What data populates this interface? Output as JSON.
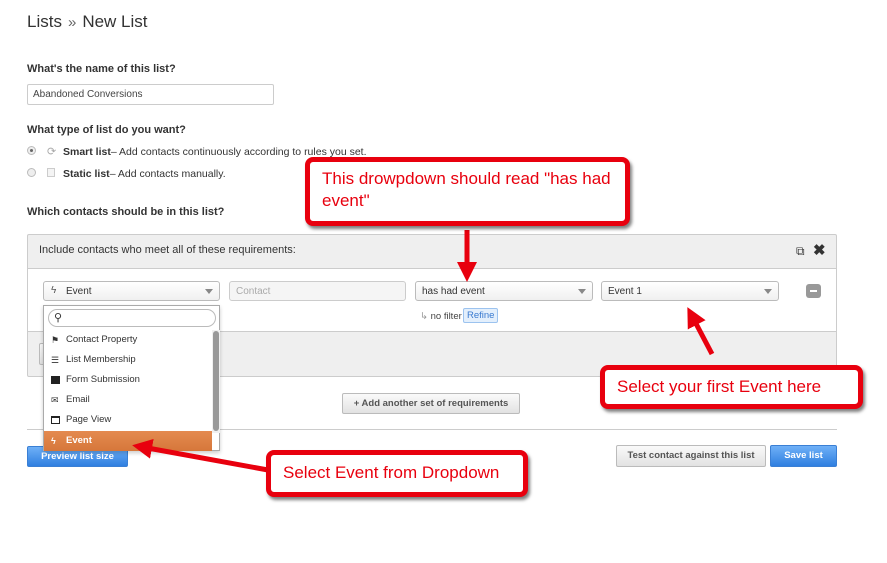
{
  "breadcrumb": {
    "parent": "Lists",
    "separator": "»",
    "current": "New List"
  },
  "name_section": {
    "label": "What's the name of this list?",
    "value": "Abandoned Conversions"
  },
  "type_section": {
    "label": "What type of list do you want?",
    "options": [
      {
        "title": "Smart list",
        "desc": "– Add contacts continuously according to rules you set.",
        "selected": true,
        "icon": "refresh-icon"
      },
      {
        "title": "Static list",
        "desc": "– Add contacts manually.",
        "selected": false,
        "icon": "document-icon"
      }
    ]
  },
  "contacts_section": {
    "label": "Which contacts should be in this list?"
  },
  "panel": {
    "header": "Include contacts who meet all of these requirements:",
    "filter_type": "Event",
    "object": "Contact",
    "operator": "has had event",
    "event": "Event 1",
    "no_filter": "no filter",
    "refine": "Refine"
  },
  "dropdown": {
    "search_placeholder": "",
    "items": [
      {
        "label": "Contact Property",
        "icon": "flag-icon"
      },
      {
        "label": "List Membership",
        "icon": "list-icon"
      },
      {
        "label": "Form Submission",
        "icon": "form-icon"
      },
      {
        "label": "Email",
        "icon": "email-icon"
      },
      {
        "label": "Page View",
        "icon": "page-icon"
      },
      {
        "label": "Event",
        "icon": "lightning-icon",
        "selected": true
      }
    ]
  },
  "buttons": {
    "add_set": "+ Add another set of requirements",
    "preview": "Preview list size",
    "test": "Test contact against this list",
    "save": "Save list"
  },
  "annotations": [
    "This drowpdown should read \"has had event\"",
    "Select your first Event here",
    "Select Event from Dropdown"
  ],
  "colors": {
    "annotation": "#e8000e",
    "selected_item": "#e0834a",
    "primary_button": "#3b86e6"
  }
}
